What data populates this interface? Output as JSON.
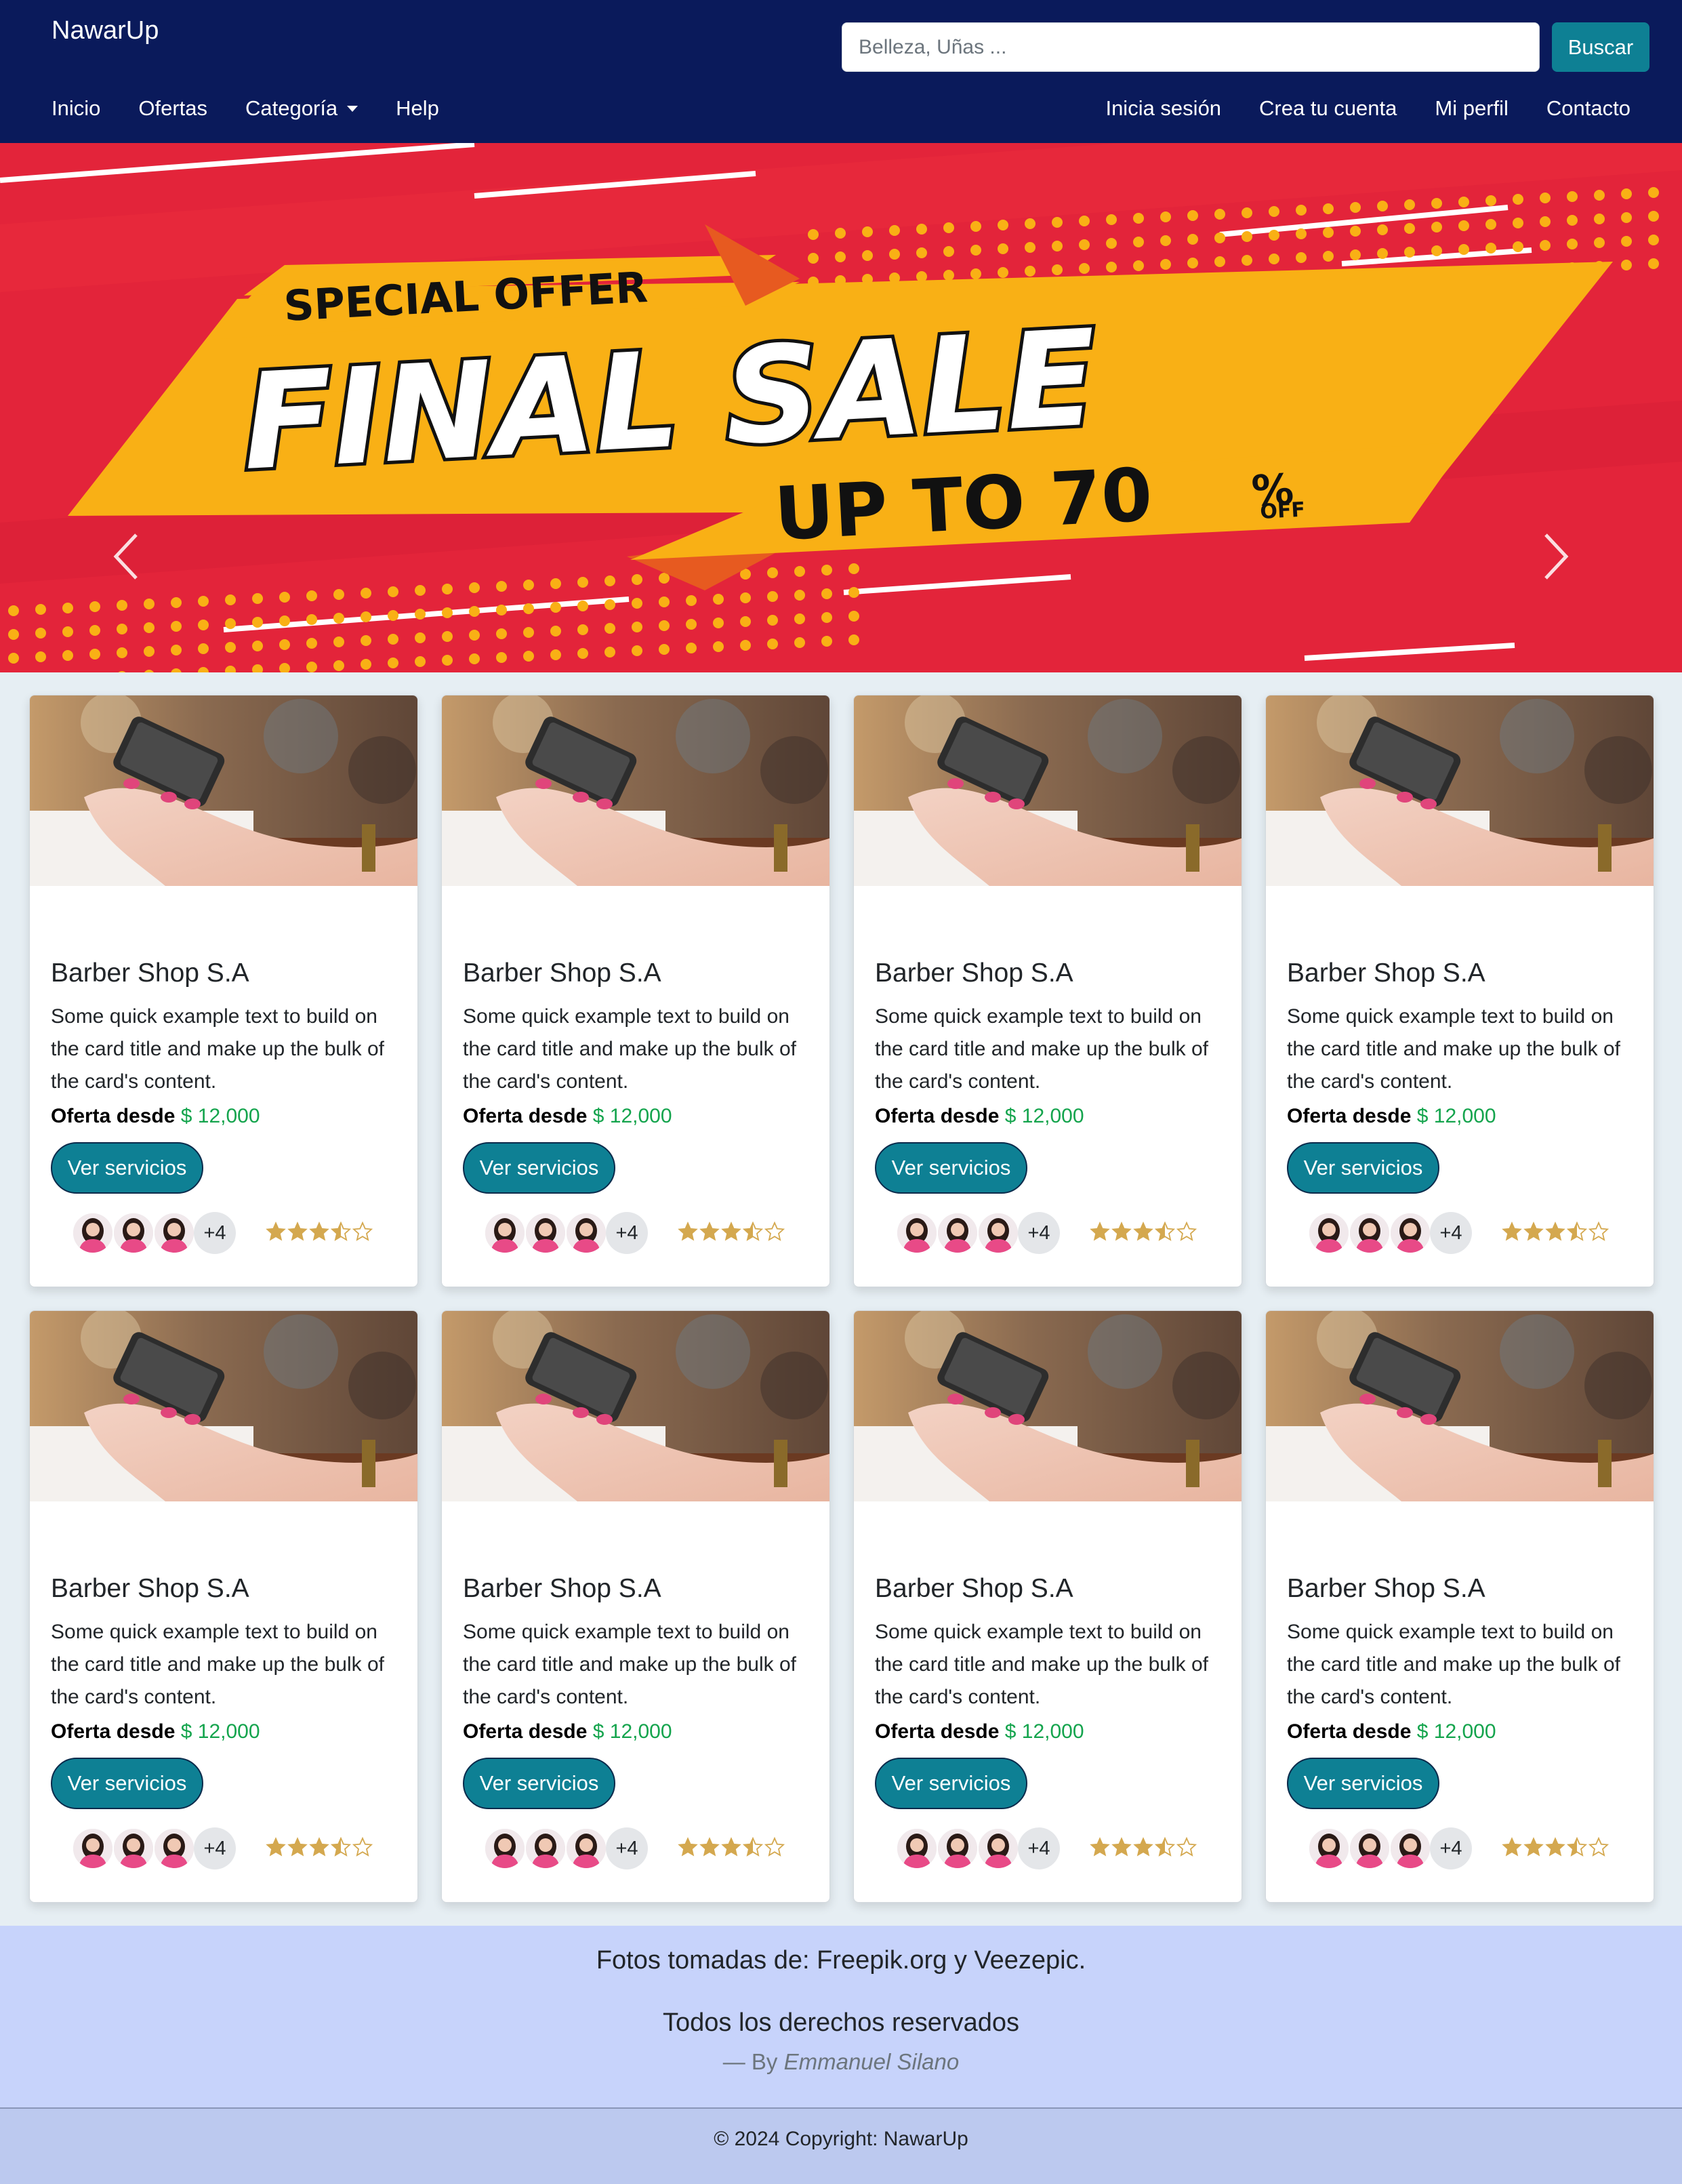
{
  "navbar": {
    "brand": "NawarUp",
    "search_placeholder": "Belleza, Uñas ...",
    "search_button": "Buscar",
    "links_left": [
      "Inicio",
      "Ofertas",
      "Categoría",
      "Help"
    ],
    "links_right": [
      "Inicia sesión",
      "Crea tu cuenta",
      "Mi perfil",
      "Contacto"
    ]
  },
  "carousel": {
    "banner": {
      "badge": "SPECIAL OFFER",
      "headline": "FINAL SALE",
      "subline": "UP TO 70",
      "percent": "%",
      "off": "OFF"
    },
    "slide_count": 3,
    "active_slide": 2,
    "colors": {
      "background": "#e3243a",
      "band": "#f9b015"
    }
  },
  "cards": [
    {
      "title": "Barber Shop S.A",
      "text": "Some quick example text to build on the card title and make up the bulk of the card's content.",
      "price_label": "Oferta desde",
      "price": "$ 12,000",
      "button": "Ver servicios",
      "more_count": "+4",
      "rating": 3.5
    },
    {
      "title": "Barber Shop S.A",
      "text": "Some quick example text to build on the card title and make up the bulk of the card's content.",
      "price_label": "Oferta desde",
      "price": "$ 12,000",
      "button": "Ver servicios",
      "more_count": "+4",
      "rating": 3.5
    },
    {
      "title": "Barber Shop S.A",
      "text": "Some quick example text to build on the card title and make up the bulk of the card's content.",
      "price_label": "Oferta desde",
      "price": "$ 12,000",
      "button": "Ver servicios",
      "more_count": "+4",
      "rating": 3.5
    },
    {
      "title": "Barber Shop S.A",
      "text": "Some quick example text to build on the card title and make up the bulk of the card's content.",
      "price_label": "Oferta desde",
      "price": "$ 12,000",
      "button": "Ver servicios",
      "more_count": "+4",
      "rating": 3.5
    },
    {
      "title": "Barber Shop S.A",
      "text": "Some quick example text to build on the card title and make up the bulk of the card's content.",
      "price_label": "Oferta desde",
      "price": "$ 12,000",
      "button": "Ver servicios",
      "more_count": "+4",
      "rating": 3.5
    },
    {
      "title": "Barber Shop S.A",
      "text": "Some quick example text to build on the card title and make up the bulk of the card's content.",
      "price_label": "Oferta desde",
      "price": "$ 12,000",
      "button": "Ver servicios",
      "more_count": "+4",
      "rating": 3.5
    },
    {
      "title": "Barber Shop S.A",
      "text": "Some quick example text to build on the card title and make up the bulk of the card's content.",
      "price_label": "Oferta desde",
      "price": "$ 12,000",
      "button": "Ver servicios",
      "more_count": "+4",
      "rating": 3.5
    },
    {
      "title": "Barber Shop S.A",
      "text": "Some quick example text to build on the card title and make up the bulk of the card's content.",
      "price_label": "Oferta desde",
      "price": "$ 12,000",
      "button": "Ver servicios",
      "more_count": "+4",
      "rating": 3.5
    }
  ],
  "footer": {
    "credit": "Fotos tomadas de: Freepik.org y Veezepic.",
    "rights": "Todos los derechos reservados",
    "by_prefix": "— By ",
    "author": "Emmanuel Silano",
    "copyright": "© 2024 Copyright: NawarUp"
  },
  "colors": {
    "navbar": "#0a1a5b",
    "accent": "#0e8094",
    "price": "#14a44d",
    "star": "#d4a84f",
    "footer": "#c7d3fb"
  }
}
